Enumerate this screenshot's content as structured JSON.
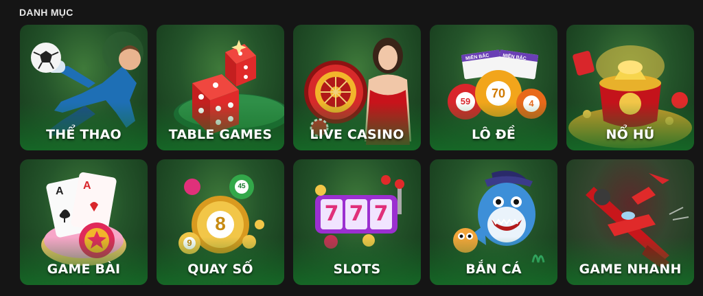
{
  "section": {
    "title": "DANH MỤC"
  },
  "categories": [
    {
      "label": "THỂ THAO",
      "icon": "soccer-goalkeeper-icon"
    },
    {
      "label": "TABLE GAMES",
      "icon": "dice-icon"
    },
    {
      "label": "LIVE CASINO",
      "icon": "roulette-dealer-icon"
    },
    {
      "label": "LÔ ĐỀ",
      "icon": "lottery-balls-icon",
      "balls": [
        "59",
        "70",
        "4"
      ],
      "tickets": [
        "MIỀN BẮC",
        "MIỀN BẮC"
      ]
    },
    {
      "label": "NỔ HŨ",
      "icon": "gold-pot-icon"
    },
    {
      "label": "GAME BÀI",
      "icon": "playing-cards-icon",
      "cards": [
        "A",
        "A"
      ]
    },
    {
      "label": "QUAY SỐ",
      "icon": "number-balls-icon",
      "balls": [
        "8",
        "45",
        "9"
      ]
    },
    {
      "label": "SLOTS",
      "icon": "slot-machine-icon",
      "reels": [
        "7",
        "7",
        "7"
      ]
    },
    {
      "label": "BẮN CÁ",
      "icon": "shark-pirate-icon"
    },
    {
      "label": "GAME NHANH",
      "icon": "airplane-icon"
    }
  ],
  "colors": {
    "background": "#151515",
    "card_green": "#24542a",
    "accent_gold": "#f2b52b",
    "accent_red": "#d9262b"
  }
}
